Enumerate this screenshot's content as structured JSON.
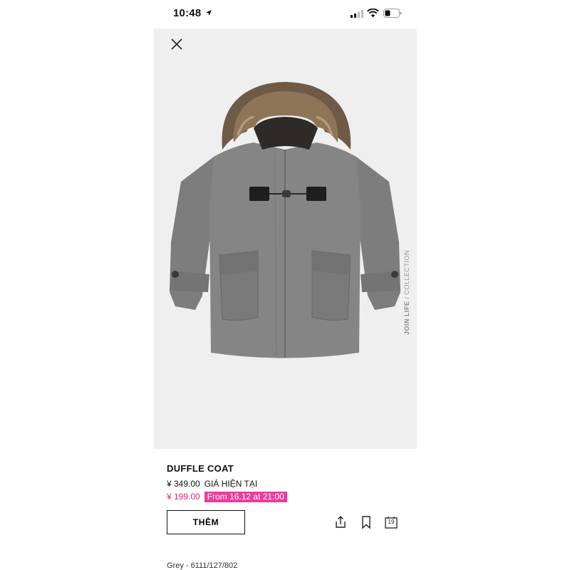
{
  "status_bar": {
    "time": "10:48"
  },
  "product": {
    "name": "DUFFLE COAT",
    "original_price": "¥ 349.00",
    "price_note": "GIÁ HIỆN TẠI",
    "sale_price": "¥ 199.00",
    "sale_badge": "From 16.12 at 21:00",
    "color_ref": "Grey - 6111/127/802"
  },
  "image_watermark": {
    "bold": "JOIN LIFE",
    "rest": " / COLLECTION"
  },
  "actions": {
    "add_label": "THÊM",
    "size_badge": "19"
  },
  "icons": {
    "close": "close-icon",
    "share": "share-icon",
    "bookmark": "bookmark-icon",
    "size_guide": "size-guide-icon",
    "location": "location-arrow-icon",
    "signal": "signal-icon",
    "wifi": "wifi-icon",
    "battery": "battery-icon"
  },
  "colors": {
    "sale": "#e5267a",
    "badge_bg": "#ec3c9c",
    "image_bg": "#efefef",
    "coat": "#7b7b7b"
  }
}
